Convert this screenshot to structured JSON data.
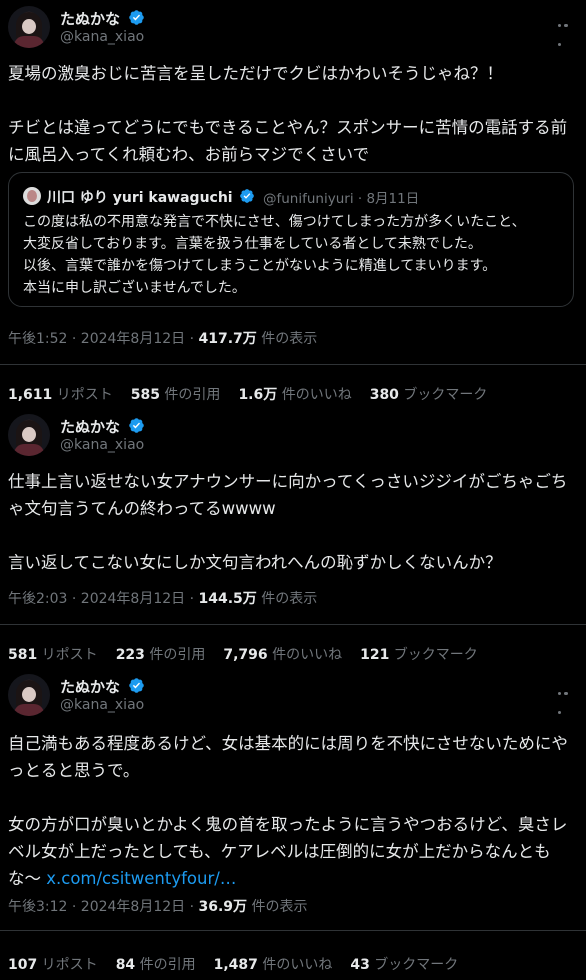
{
  "accent_color": "#1d9bf0",
  "verified_icon": "verified-badge-icon",
  "tweets": [
    {
      "name": "たぬかな",
      "handle": "@kana_xiao",
      "text": "夏場の激臭おじに苦言を呈しただけでクビはかわいそうじゃね？！\n\nチビとは違ってどうにでもできることやん？スポンサーに苦情の電話する前に風呂入ってくれ頼むわ、お前らマジでくさいで",
      "quote": {
        "name": "川口 ゆり yuri kawaguchi",
        "handle": "@funifuniyuri · 8月11日",
        "text": "この度は私の不用意な発言で不快にさせ、傷つけてしまった方が多くいたこと、\n大変反省しております。言葉を扱う仕事をしている者として未熟でした。\n以後、言葉で誰かを傷つけてしまうことがないように精進してまいります。\n本当に申し訳ございませんでした。"
      },
      "time": "午後1:52 · 2024年8月12日 · ",
      "views": "417.7万",
      "views_label": " 件の表示",
      "stats": [
        {
          "value": "1,611",
          "label": " リポスト"
        },
        {
          "value": "585",
          "label": " 件の引用"
        },
        {
          "value": "1.6万",
          "label": " 件のいいね"
        },
        {
          "value": "380",
          "label": " ブックマーク"
        }
      ]
    },
    {
      "name": "たぬかな",
      "handle": "@kana_xiao",
      "text": "仕事上言い返せない女アナウンサーに向かってくっさいジジイがごちゃごちゃ文句言うてんの終わってるwwww\n\n言い返してこない女にしか文句言われへんの恥ずかしくないんか？",
      "time": "午後2:03 · 2024年8月12日 · ",
      "views": "144.5万",
      "views_label": " 件の表示",
      "stats": [
        {
          "value": "581",
          "label": " リポスト"
        },
        {
          "value": "223",
          "label": " 件の引用"
        },
        {
          "value": "7,796",
          "label": " 件のいいね"
        },
        {
          "value": "121",
          "label": " ブックマーク"
        }
      ]
    },
    {
      "name": "たぬかな",
      "handle": "@kana_xiao",
      "text": "自己満もある程度あるけど、女は基本的には周りを不快にさせないためにやっとると思うで。\n\n女の方が口が臭いとかよく鬼の首を取ったように言うやつおるけど、臭さレベル女が上だったとしても、ケアレベルは圧倒的に女が上だからなんともな〜 ",
      "link": "x.com/csitwentyfour/…",
      "time": "午後3:12 · 2024年8月12日 · ",
      "views": "36.9万",
      "views_label": " 件の表示",
      "stats": [
        {
          "value": "107",
          "label": " リポスト"
        },
        {
          "value": "84",
          "label": " 件の引用"
        },
        {
          "value": "1,487",
          "label": " 件のいいね"
        },
        {
          "value": "43",
          "label": " ブックマーク"
        }
      ]
    }
  ]
}
